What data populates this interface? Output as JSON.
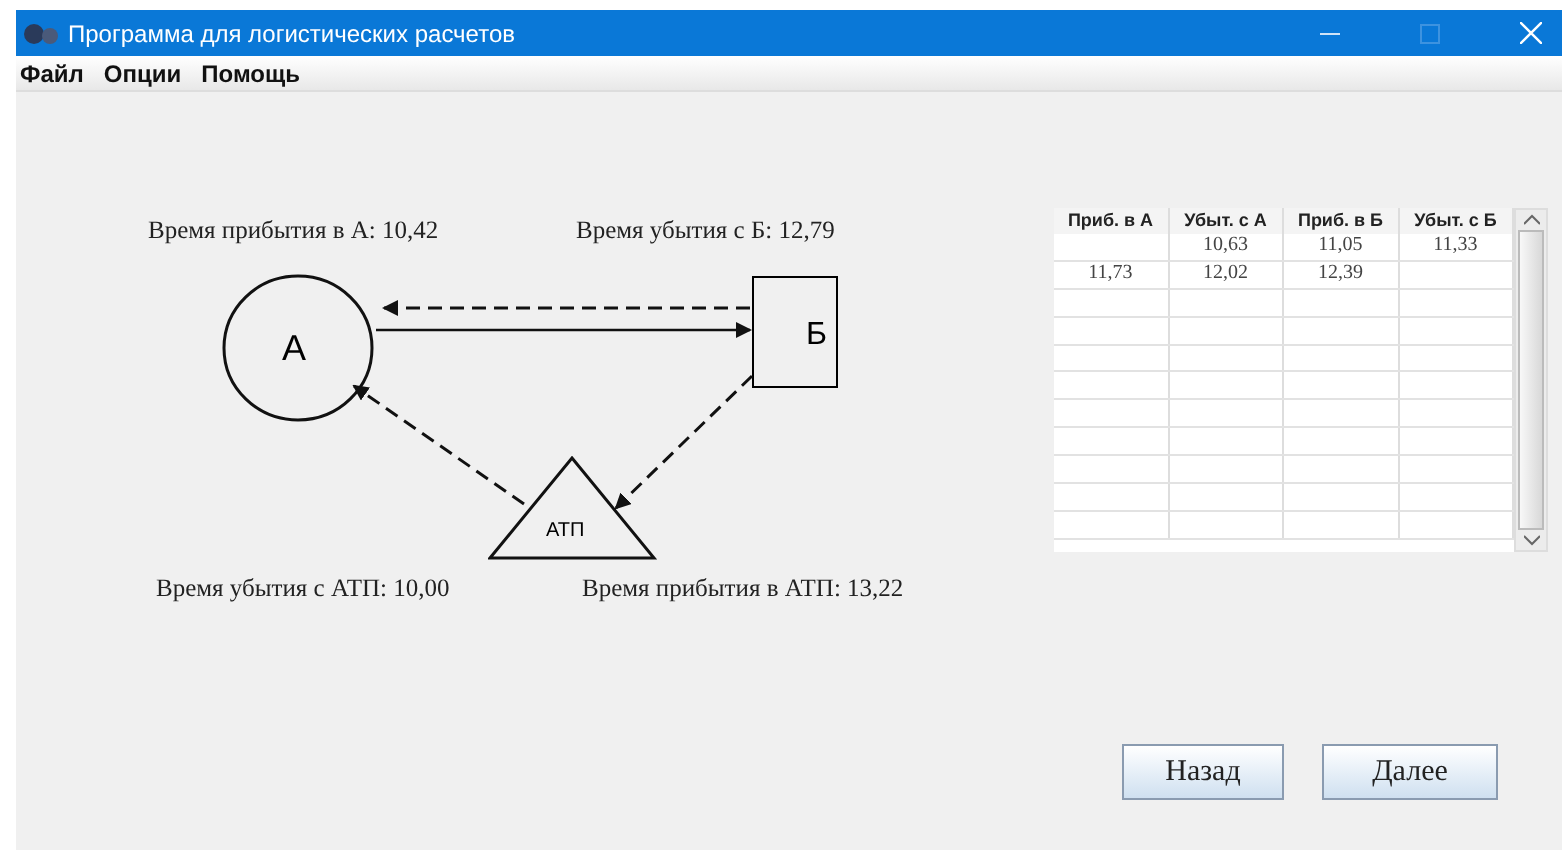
{
  "window": {
    "title": "Программа для логистических расчетов"
  },
  "menu": [
    "Файл",
    "Опции",
    "Помощь"
  ],
  "diagram": {
    "nodes": [
      {
        "kind": "circle",
        "label": "А"
      },
      {
        "kind": "square",
        "label": "Б"
      },
      {
        "kind": "triangle",
        "label": "АТП"
      }
    ],
    "times": [
      "Время прибытия в А: 10,42",
      "Время убытия с Б: 12,79",
      "Время убытия с АТП: 10,00",
      "Время прибытия в АТП: 13,22"
    ]
  },
  "table": {
    "columns": [
      "Приб. в А",
      "Убыт. с А",
      "Приб. в Б",
      "Убыт. с Б"
    ],
    "rows": [
      [
        "",
        "10,63",
        "11,05",
        "11,33"
      ],
      [
        "11,73",
        "12,02",
        "12,39",
        ""
      ]
    ]
  },
  "buttons": [
    "Назад",
    "Далее"
  ]
}
